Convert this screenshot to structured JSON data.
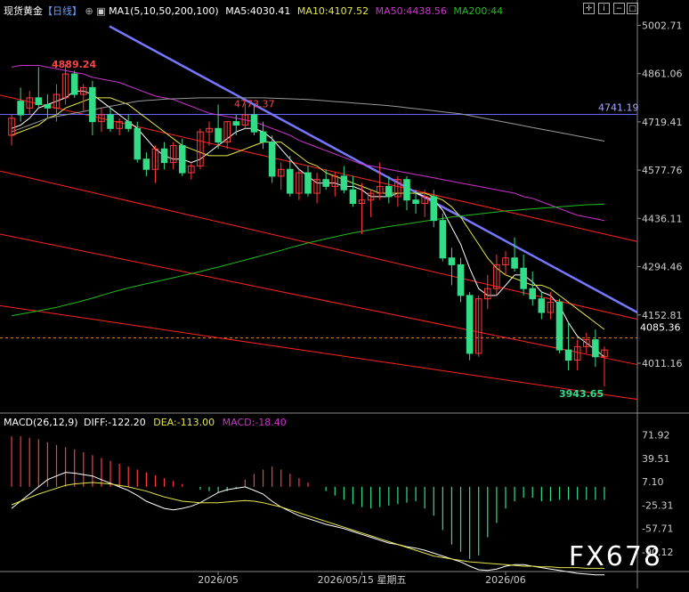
{
  "header": {
    "instrument": "现货黄金",
    "period": "【日线】",
    "ma_label": "MA1(5,10,50,200,100)",
    "ma5": "MA5:4030.41",
    "ma10": "MA10:4107.52",
    "ma50": "MA50:4438.56",
    "ma200": "MA200:44"
  },
  "macd_header": {
    "label": "MACD(26,12,9)",
    "diff": "DIFF:-122.20",
    "dea": "DEA:-113.00",
    "macd": "MACD:-18.40"
  },
  "watermark": "FX678",
  "colors": {
    "up": "#ff3b3b",
    "down": "#33dd88",
    "ma5": "#ffffff",
    "ma10": "#e6e64c",
    "ma50": "#cc33cc",
    "ma200": "#22bb22",
    "ma100": "#999999",
    "trend": "#7777ff",
    "channel": "#ff2222",
    "hline": "#6666ff"
  },
  "chart_data": {
    "type": "candlestick",
    "price_ticks": [
      5002.71,
      4861.06,
      4719.41,
      4577.76,
      4436.11,
      4294.46,
      4152.81,
      4011.16
    ],
    "price_range": [
      3870,
      5030
    ],
    "current_price": "4085.36",
    "annotations": {
      "high1": "4889.24",
      "high2": "4773.37",
      "hline": "4741.19",
      "low": "3943.65"
    },
    "x_labels": [
      "2026/05",
      "2026/05/15 星期五",
      "2026/06"
    ],
    "x_label_index": [
      23,
      39,
      55
    ],
    "macd_ticks": [
      "71.92",
      "39.51",
      "7.10",
      "-25.31",
      "-57.71",
      "-90.12"
    ],
    "macd_range": [
      -115,
      85
    ],
    "candles": [
      [
        4680,
        4740,
        4650,
        4730
      ],
      [
        4780,
        4820,
        4720,
        4740
      ],
      [
        4760,
        4810,
        4740,
        4790
      ],
      [
        4790,
        4880,
        4760,
        4770
      ],
      [
        4770,
        4800,
        4730,
        4760
      ],
      [
        4760,
        4830,
        4720,
        4800
      ],
      [
        4790,
        4889,
        4770,
        4860
      ],
      [
        4860,
        4870,
        4790,
        4800
      ],
      [
        4800,
        4830,
        4750,
        4820
      ],
      [
        4820,
        4840,
        4680,
        4720
      ],
      [
        4720,
        4760,
        4690,
        4740
      ],
      [
        4740,
        4760,
        4690,
        4700
      ],
      [
        4700,
        4730,
        4680,
        4720
      ],
      [
        4720,
        4740,
        4690,
        4700
      ],
      [
        4700,
        4720,
        4600,
        4610
      ],
      [
        4610,
        4630,
        4560,
        4580
      ],
      [
        4580,
        4650,
        4540,
        4640
      ],
      [
        4640,
        4660,
        4580,
        4600
      ],
      [
        4600,
        4660,
        4580,
        4650
      ],
      [
        4650,
        4670,
        4560,
        4570
      ],
      [
        4570,
        4600,
        4550,
        4590
      ],
      [
        4590,
        4700,
        4580,
        4690
      ],
      [
        4690,
        4720,
        4650,
        4700
      ],
      [
        4700,
        4770,
        4640,
        4660
      ],
      [
        4660,
        4720,
        4640,
        4720
      ],
      [
        4720,
        4740,
        4680,
        4710
      ],
      [
        4710,
        4773,
        4700,
        4740
      ],
      [
        4740,
        4770,
        4680,
        4690
      ],
      [
        4690,
        4720,
        4640,
        4660
      ],
      [
        4660,
        4680,
        4540,
        4560
      ],
      [
        4560,
        4600,
        4520,
        4580
      ],
      [
        4580,
        4620,
        4500,
        4510
      ],
      [
        4510,
        4580,
        4490,
        4570
      ],
      [
        4570,
        4590,
        4500,
        4510
      ],
      [
        4510,
        4570,
        4480,
        4550
      ],
      [
        4550,
        4580,
        4520,
        4530
      ],
      [
        4530,
        4570,
        4500,
        4560
      ],
      [
        4560,
        4590,
        4510,
        4520
      ],
      [
        4520,
        4560,
        4470,
        4480
      ],
      [
        4480,
        4540,
        4390,
        4490
      ],
      [
        4490,
        4520,
        4440,
        4510
      ],
      [
        4510,
        4600,
        4490,
        4530
      ],
      [
        4530,
        4560,
        4480,
        4500
      ],
      [
        4500,
        4560,
        4470,
        4550
      ],
      [
        4550,
        4560,
        4460,
        4490
      ],
      [
        4490,
        4520,
        4450,
        4480
      ],
      [
        4480,
        4520,
        4440,
        4500
      ],
      [
        4500,
        4520,
        4410,
        4430
      ],
      [
        4430,
        4450,
        4310,
        4320
      ],
      [
        4320,
        4350,
        4240,
        4300
      ],
      [
        4300,
        4320,
        4190,
        4210
      ],
      [
        4210,
        4220,
        4020,
        4040
      ],
      [
        4040,
        4210,
        4030,
        4200
      ],
      [
        4200,
        4270,
        4170,
        4230
      ],
      [
        4230,
        4330,
        4210,
        4300
      ],
      [
        4300,
        4340,
        4270,
        4320
      ],
      [
        4320,
        4380,
        4280,
        4290
      ],
      [
        4290,
        4330,
        4210,
        4230
      ],
      [
        4230,
        4280,
        4180,
        4200
      ],
      [
        4200,
        4220,
        4140,
        4160
      ],
      [
        4160,
        4220,
        4140,
        4190
      ],
      [
        4190,
        4200,
        4040,
        4050
      ],
      [
        4050,
        4130,
        3990,
        4020
      ],
      [
        4020,
        4080,
        3990,
        4060
      ],
      [
        4060,
        4100,
        4040,
        4080
      ],
      [
        4080,
        4110,
        4000,
        4030
      ],
      [
        4030,
        4060,
        3943,
        4050
      ]
    ],
    "series": [
      {
        "name": "MA5",
        "values": [
          4700,
          4710,
          4730,
          4760,
          4770,
          4780,
          4790,
          4810,
          4810,
          4800,
          4780,
          4760,
          4740,
          4720,
          4700,
          4670,
          4640,
          4620,
          4610,
          4610,
          4600,
          4610,
          4630,
          4650,
          4670,
          4690,
          4700,
          4700,
          4690,
          4670,
          4640,
          4610,
          4580,
          4560,
          4540,
          4540,
          4540,
          4530,
          4530,
          4520,
          4500,
          4500,
          4500,
          4510,
          4510,
          4510,
          4500,
          4490,
          4460,
          4410,
          4360,
          4290,
          4230,
          4210,
          4210,
          4240,
          4270,
          4270,
          4250,
          4220,
          4210,
          4180,
          4130,
          4090,
          4070,
          4050,
          4030
        ]
      },
      {
        "name": "MA10",
        "values": [
          4680,
          4690,
          4700,
          4710,
          4730,
          4740,
          4760,
          4770,
          4780,
          4790,
          4790,
          4790,
          4780,
          4770,
          4750,
          4730,
          4710,
          4690,
          4670,
          4650,
          4640,
          4630,
          4620,
          4620,
          4620,
          4630,
          4640,
          4650,
          4660,
          4660,
          4660,
          4640,
          4620,
          4600,
          4590,
          4570,
          4560,
          4550,
          4540,
          4530,
          4520,
          4510,
          4510,
          4510,
          4510,
          4510,
          4510,
          4500,
          4490,
          4470,
          4440,
          4400,
          4360,
          4320,
          4290,
          4270,
          4260,
          4250,
          4240,
          4240,
          4230,
          4210,
          4190,
          4170,
          4150,
          4130,
          4110
        ]
      },
      {
        "name": "MA50",
        "values": [
          4880,
          4885,
          4885,
          4885,
          4880,
          4875,
          4870,
          4865,
          4860,
          4850,
          4845,
          4840,
          4835,
          4825,
          4815,
          4805,
          4795,
          4790,
          4785,
          4775,
          4765,
          4755,
          4745,
          4740,
          4735,
          4730,
          4725,
          4720,
          4710,
          4700,
          4690,
          4680,
          4665,
          4655,
          4645,
          4635,
          4625,
          4615,
          4605,
          4595,
          4590,
          4585,
          4580,
          4575,
          4570,
          4565,
          4560,
          4555,
          4550,
          4545,
          4540,
          4535,
          4530,
          4525,
          4520,
          4515,
          4510,
          4500,
          4495,
          4485,
          4475,
          4465,
          4455,
          4445,
          4440,
          4435,
          4430
        ]
      },
      {
        "name": "MA100",
        "values": [
          4690,
          4700,
          4710,
          4720,
          4730,
          4735,
          4740,
          4745,
          4750,
          4755,
          4760,
          4765,
          4770,
          4775,
          4780,
          4782,
          4784,
          4786,
          4787,
          4788,
          4789,
          4790,
          4790,
          4790,
          4790,
          4790,
          4790,
          4790,
          4790,
          4789,
          4788,
          4787,
          4786,
          4785,
          4783,
          4781,
          4779,
          4777,
          4775,
          4773,
          4771,
          4769,
          4767,
          4764,
          4761,
          4758,
          4755,
          4752,
          4749,
          4746,
          4743,
          4738,
          4733,
          4728,
          4723,
          4718,
          4713,
          4708,
          4703,
          4698,
          4693,
          4688,
          4683,
          4678,
          4673,
          4668,
          4663
        ]
      },
      {
        "name": "MA200",
        "values": [
          4150,
          4155,
          4160,
          4165,
          4170,
          4175,
          4182,
          4188,
          4195,
          4202,
          4210,
          4218,
          4225,
          4232,
          4238,
          4244,
          4250,
          4256,
          4262,
          4268,
          4274,
          4280,
          4287,
          4293,
          4300,
          4307,
          4314,
          4321,
          4328,
          4335,
          4342,
          4350,
          4357,
          4364,
          4370,
          4376,
          4382,
          4388,
          4393,
          4398,
          4403,
          4408,
          4412,
          4416,
          4420,
          4424,
          4428,
          4432,
          4436,
          4440,
          4443,
          4446,
          4449,
          4452,
          4455,
          4458,
          4460,
          4462,
          4464,
          4466,
          4468,
          4470,
          4472,
          4474,
          4476,
          4477,
          4478
        ]
      }
    ],
    "macd": {
      "hist": [
        70,
        70,
        68,
        66,
        62,
        58,
        55,
        52,
        48,
        44,
        40,
        36,
        32,
        28,
        24,
        20,
        16,
        12,
        8,
        4,
        0,
        -4,
        -6,
        -8,
        -6,
        -2,
        10,
        18,
        24,
        28,
        24,
        18,
        12,
        6,
        0,
        -6,
        -12,
        -18,
        -24,
        -28,
        -30,
        -28,
        -26,
        -24,
        -22,
        -20,
        -30,
        -40,
        -60,
        -80,
        -90,
        -100,
        -95,
        -70,
        -50,
        -30,
        -20,
        -15,
        -15,
        -20,
        -20,
        -18,
        -18,
        -18,
        -18,
        -18,
        -18
      ],
      "diff": [
        -30,
        -20,
        -10,
        0,
        10,
        15,
        20,
        19,
        17,
        15,
        10,
        5,
        0,
        -5,
        -12,
        -20,
        -25,
        -30,
        -32,
        -30,
        -27,
        -22,
        -15,
        -8,
        -4,
        -2,
        0,
        -5,
        -10,
        -20,
        -28,
        -34,
        -40,
        -44,
        -48,
        -52,
        -55,
        -58,
        -62,
        -66,
        -70,
        -74,
        -78,
        -80,
        -83,
        -85,
        -88,
        -92,
        -96,
        -100,
        -104,
        -110,
        -115,
        -116,
        -114,
        -110,
        -108,
        -108,
        -110,
        -112,
        -114,
        -116,
        -118,
        -120,
        -121,
        -122,
        -122
      ],
      "dea": [
        -25,
        -20,
        -15,
        -10,
        -6,
        -2,
        2,
        4,
        5,
        6,
        5,
        4,
        2,
        0,
        -3,
        -6,
        -10,
        -14,
        -17,
        -20,
        -21,
        -22,
        -22,
        -22,
        -21,
        -20,
        -19,
        -20,
        -22,
        -25,
        -28,
        -32,
        -36,
        -40,
        -44,
        -48,
        -52,
        -56,
        -60,
        -64,
        -68,
        -72,
        -76,
        -80,
        -84,
        -88,
        -92,
        -96,
        -98,
        -100,
        -102,
        -104,
        -105,
        -106,
        -107,
        -108,
        -109,
        -110,
        -110,
        -111,
        -111,
        -112,
        -112,
        -112,
        -113,
        -113,
        -113
      ]
    }
  }
}
